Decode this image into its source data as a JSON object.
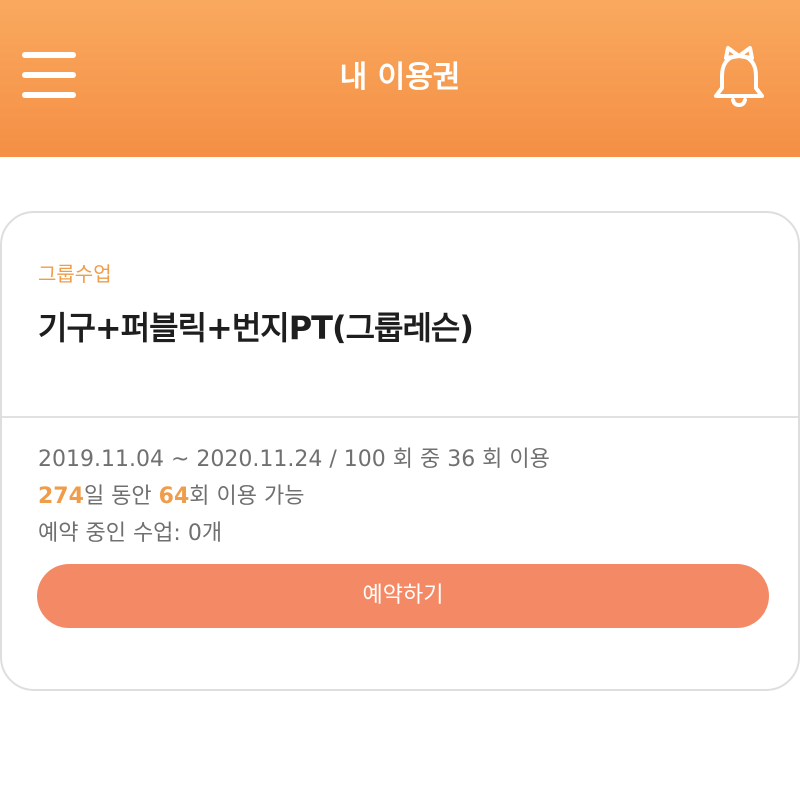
{
  "header": {
    "title": "내 이용권",
    "menu_icon": "hamburger-menu-icon",
    "bell_icon": "bell-icon"
  },
  "colors": {
    "header_gradient_top": "#f9a95e",
    "header_gradient_bottom": "#f48f45",
    "accent": "#ef9d4a",
    "button": "#f48a65"
  },
  "ticket": {
    "category": "그룹수업",
    "name": "기구+퍼블릭+번지PT(그룹레슨)",
    "period": "2019.11.04 ~ 2020.11.24 / 100 회 중 36 회 이용",
    "remaining_days": "274",
    "remaining_days_suffix": "일 동안 ",
    "remaining_count": "64",
    "remaining_count_suffix": "회 이용 가능",
    "reservation_status": "예약 중인 수업: 0개",
    "reserve_button": "예약하기"
  }
}
